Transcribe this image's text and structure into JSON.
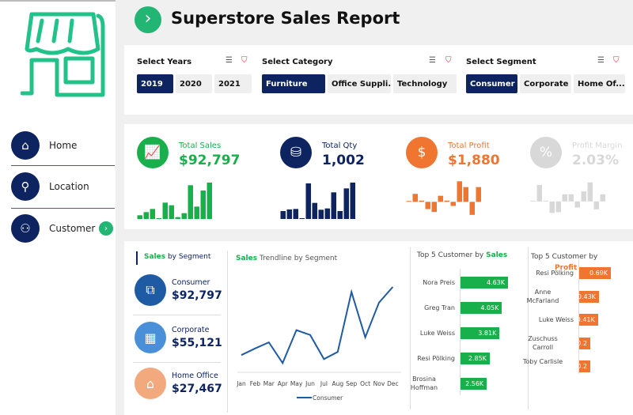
{
  "header": {
    "title": "Superstore Sales Report",
    "nav_icon": "chevron-right-icon"
  },
  "sidebar": {
    "logo": "store-icon",
    "items": [
      {
        "label": "Home",
        "icon": "home-icon"
      },
      {
        "label": "Location",
        "icon": "location-pin-icon"
      },
      {
        "label": "Customer",
        "icon": "customer-network-icon",
        "active": true
      }
    ]
  },
  "filters": {
    "years": {
      "title": "Select Years",
      "options": [
        "2019",
        "2020",
        "2021"
      ],
      "selected": "2019"
    },
    "category": {
      "title": "Select Category",
      "options": [
        "Furniture",
        "Office Suppli...",
        "Technology"
      ],
      "selected": "Furniture"
    },
    "segment": {
      "title": "Select Segment",
      "options": [
        "Consumer",
        "Corporate",
        "Home Of..."
      ],
      "selected": "Consumer"
    }
  },
  "kpis": [
    {
      "label": "Total Sales",
      "value": "$92,797",
      "color": "#18b04a",
      "icon": "chart-growth-icon"
    },
    {
      "label": "Total Qty",
      "value": "1,002",
      "color": "#0d2461",
      "icon": "coins-stack-icon"
    },
    {
      "label": "Total Profit",
      "value": "$1,880",
      "color": "#ef7530",
      "icon": "profit-chart-icon"
    },
    {
      "label": "Profit Margin",
      "value": "2.03%",
      "color": "#d8d8d8",
      "icon": "percent-icon"
    }
  ],
  "chart_data": [
    {
      "type": "bar",
      "name": "sales-sparkline",
      "values": [
        14,
        26,
        38,
        2,
        62,
        52,
        7,
        22,
        128,
        47,
        108,
        138
      ]
    },
    {
      "type": "bar",
      "name": "qty-sparkline",
      "values": [
        30,
        36,
        38,
        2,
        135,
        61,
        35,
        40,
        101,
        30,
        116,
        138
      ]
    },
    {
      "type": "bar",
      "name": "profit-sparkline",
      "values": [
        2,
        33,
        5,
        -30,
        -42,
        25,
        5,
        -17,
        85,
        61,
        -54,
        61
      ]
    },
    {
      "type": "bar",
      "name": "margin-sparkline",
      "values": [
        2,
        46,
        2,
        -32,
        -30,
        20,
        20,
        -17,
        28,
        53,
        -22,
        20
      ]
    },
    {
      "type": "line",
      "title_highlight": "Sales",
      "title_rest": " Trendline by Segment",
      "categories": [
        "Jan",
        "Feb",
        "Mar",
        "Apr",
        "May",
        "Jun",
        "Jul",
        "Aug",
        "Sep",
        "Oct",
        "Nov",
        "Dec"
      ],
      "series": [
        {
          "name": "Consumer",
          "values": [
            3445,
            4770,
            5990,
            1855,
            8430,
            7475,
            2650,
            4080,
            16060,
            7000,
            13940,
            17070
          ]
        }
      ],
      "color": "#1f5ba4"
    },
    {
      "type": "bar",
      "orientation": "horizontal",
      "title_prefix": "Top 5 Customer by ",
      "title_highlight": "Sales",
      "categories": [
        "Nora Preis",
        "Greg Tran",
        "Luke Weiss",
        "Resi Pölking",
        "Brosina Hoffman"
      ],
      "values": [
        4.63,
        4.05,
        3.81,
        2.85,
        2.56
      ],
      "labels": [
        "4.63K",
        "4.05K",
        "3.81K",
        "2.85K",
        "2.56K"
      ],
      "color": "#18b04a"
    },
    {
      "type": "bar",
      "orientation": "horizontal",
      "title_prefix": "Top 5 Customer by",
      "title_highlight": "Profit",
      "categories": [
        "Resi Pölking",
        "Anne McFarland",
        "Luke Weiss",
        "Zuschuss Carroll",
        "Toby Carlisle"
      ],
      "values": [
        0.69,
        0.43,
        0.41,
        0.2,
        0.2
      ],
      "labels": [
        "0.69K",
        "0.43K",
        "0.41K",
        "0.2",
        "0.2"
      ],
      "color": "#ef7530"
    }
  ],
  "segments": {
    "title_highlight": "Sales",
    "title_rest": " by Segment",
    "items": [
      {
        "label": "Consumer",
        "value": "$92,797",
        "color": "#1f5ba4",
        "icon": "consumer-icon"
      },
      {
        "label": "Corporate",
        "value": "$55,121",
        "color": "#4a90d9",
        "icon": "corporate-building-icon"
      },
      {
        "label": "Home Office",
        "value": "$27,467",
        "color": "#f2a97e",
        "icon": "home-office-icon"
      }
    ]
  }
}
